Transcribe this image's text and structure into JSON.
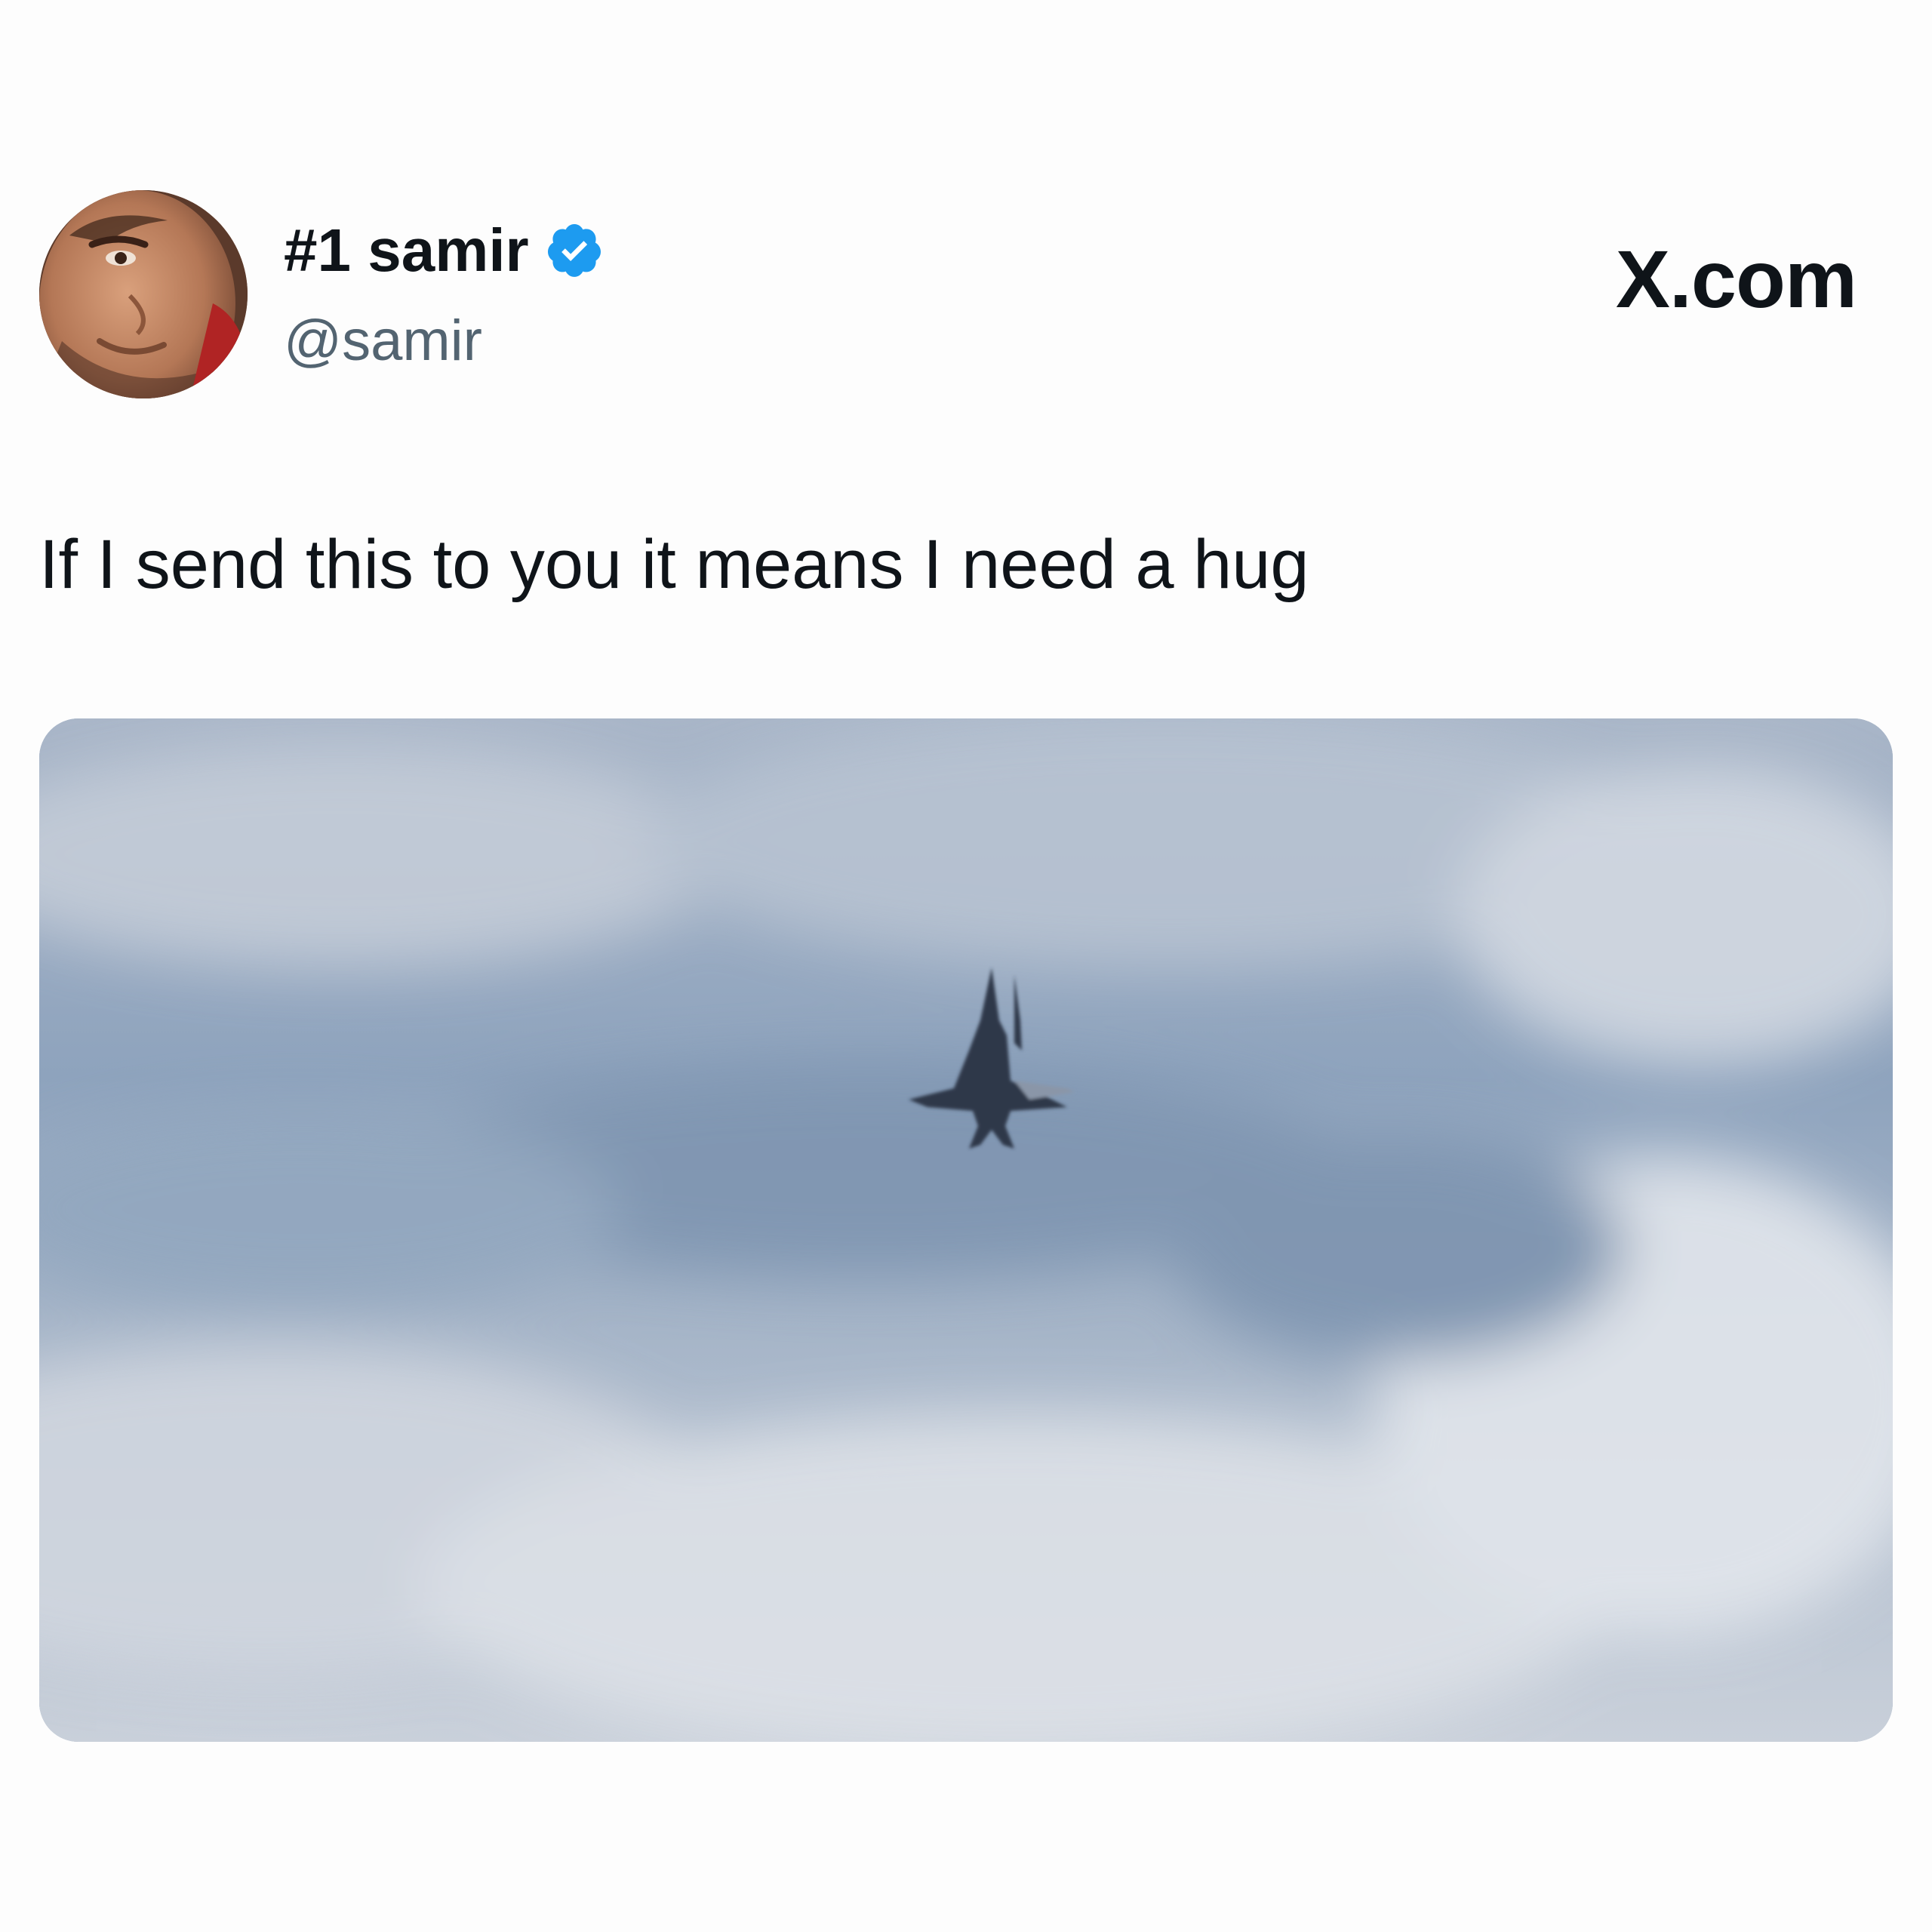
{
  "tweet": {
    "display_name": "#1 samir",
    "handle": "@samir",
    "verified": true,
    "text": "If I send this to you it means I need a hug",
    "site_label": "X.com",
    "avatar_icon": "profile-photo",
    "verified_icon": "verified-badge-icon",
    "media_subject": "fighter-jet-photo"
  },
  "colors": {
    "verified_badge": "#1d9bf0",
    "handle_text": "#536471",
    "primary_text": "#0f1419",
    "background": "#fdfdfd"
  }
}
